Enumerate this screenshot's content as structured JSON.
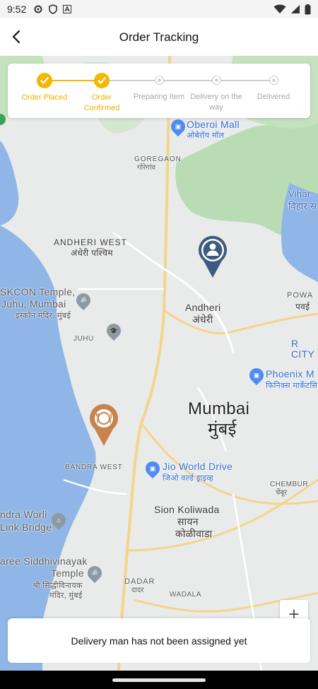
{
  "status_bar": {
    "time": "9:52"
  },
  "header": {
    "title": "Order Tracking"
  },
  "stepper": {
    "steps": [
      {
        "label": "Order Placed",
        "state": "done"
      },
      {
        "label": "Order Confirmed",
        "state": "done"
      },
      {
        "label": "Preparing Item",
        "state": "pending"
      },
      {
        "label": "Delivery on the way",
        "state": "pending"
      },
      {
        "label": "Delivered",
        "state": "pending"
      }
    ],
    "accent_color": "#f5b800"
  },
  "map": {
    "labels": {
      "oberoi": "Oberoi Mall",
      "oberoi_hi": "ओबेरॉय मॉल",
      "goregaon": "GOREGAON",
      "goregaon_hi": "गोरेगांव",
      "vihar": "Vihar L",
      "vihar_hi": "विहार स",
      "andheri_west": "ANDHERI WEST",
      "andheri_west_hi": "अंधेरी पश्चिम",
      "iskcon_1": "SKCON Temple,",
      "iskcon_2": "Juhu, Mumbai",
      "iskcon_hi": "इस्कॉन मंदिर, मुंबई",
      "powai": "POWA",
      "powai_hi": "पवई",
      "andheri": "Andheri",
      "andheri_hi": "अंधेरी",
      "juhu": "JUHU",
      "r_city": "R CITY",
      "phoenix": "Phoenix M",
      "phoenix_hi": "फिनिक्स मार्केटसि",
      "mumbai": "Mumbai",
      "mumbai_hi": "मुंबई",
      "bandra_west": "BANDRA WEST",
      "jio": "Jio World Drive",
      "jio_hi": "जिओ वर्ल्ड ड्राइव्ह",
      "chembur": "CHEMBUR",
      "chembur_hi": "चेंबूर",
      "worli_1": "ndra Worli",
      "worli_2": "Link Bridge",
      "sion": "Sion Koliwada",
      "sion_hi_1": "सायन",
      "sion_hi_2": "कोळीवाडा",
      "siddhi_1": "aree Siddhivinayak",
      "siddhi_2": "Temple",
      "siddhi_hi_1": "श्री सिद्धीविनायक",
      "siddhi_hi_2": "मंदिर, मुंबई",
      "dadar": "DADAR",
      "dadar_hi": "दादर",
      "wadala": "WADALA"
    },
    "markers": [
      {
        "name": "customer-location",
        "color": "#3d5a80"
      },
      {
        "name": "restaurant-location",
        "color": "#c7834b"
      }
    ]
  },
  "zoom": {
    "in_label": "+"
  },
  "bottom_card": {
    "message": "Delivery man has not been assigned yet"
  }
}
